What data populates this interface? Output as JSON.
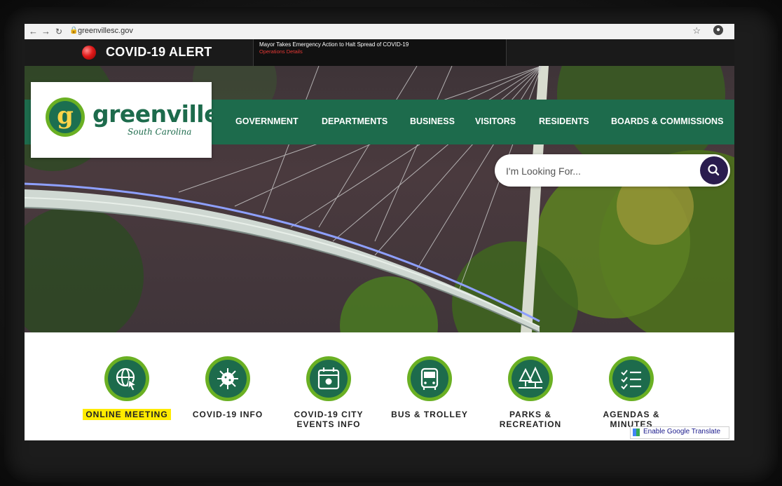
{
  "browser": {
    "url": "greenvillesc.gov"
  },
  "alert": {
    "title": "COVID-19 ALERT",
    "headline": "Mayor Takes Emergency Action to Halt Spread of COVID-19",
    "link": "Operations Details"
  },
  "logo": {
    "letter": "g",
    "name": "greenville",
    "state": "South Carolina"
  },
  "nav": {
    "items": [
      {
        "label": "GOVERNMENT"
      },
      {
        "label": "DEPARTMENTS"
      },
      {
        "label": "BUSINESS"
      },
      {
        "label": "VISITORS"
      },
      {
        "label": "RESIDENTS"
      },
      {
        "label": "BOARDS & COMMISSIONS"
      }
    ]
  },
  "search": {
    "placeholder": "I'm Looking For..."
  },
  "quick_links": [
    {
      "label": "ONLINE MEETING",
      "icon": "globe-cursor-icon"
    },
    {
      "label": "COVID-19 INFO",
      "icon": "virus-icon"
    },
    {
      "label": "COVID-19 CITY EVENTS INFO",
      "icon": "calendar-icon"
    },
    {
      "label": "BUS & TROLLEY",
      "icon": "bus-icon"
    },
    {
      "label": "PARKS & RECREATION",
      "icon": "trees-icon"
    },
    {
      "label": "AGENDAS & MINUTES",
      "icon": "checklist-icon"
    }
  ],
  "translate": {
    "label": "Enable Google Translate"
  },
  "colors": {
    "brand_green": "#1d6b4c",
    "accent_lime": "#6ab023",
    "highlight": "#ffeb00",
    "search_button": "#2a1c4e",
    "alert_red": "#e53935"
  }
}
